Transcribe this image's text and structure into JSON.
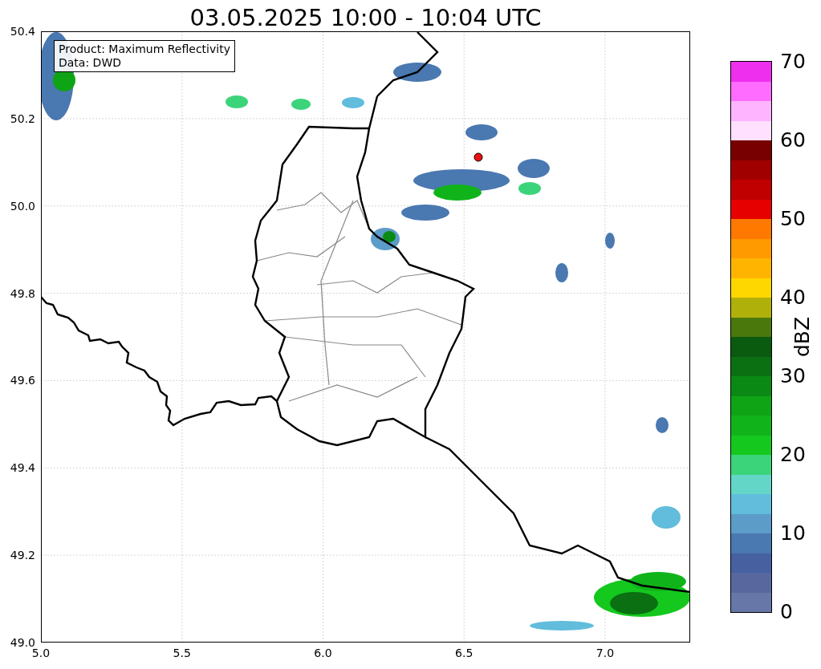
{
  "title": "03.05.2025 10:00 - 10:04 UTC",
  "map": {
    "x_ticks": [
      "5.0",
      "5.5",
      "6.0",
      "6.5",
      "7.0"
    ],
    "y_ticks": [
      "50.4",
      "50.2",
      "50.0",
      "49.8",
      "49.6",
      "49.4",
      "49.2",
      "49.0"
    ],
    "legend_lines": [
      "Product: Maximum Reflectivity",
      "Data: DWD"
    ]
  },
  "colorbar": {
    "label": "dBZ",
    "ticks": [
      "70",
      "60",
      "50",
      "40",
      "30",
      "20",
      "10",
      "0"
    ],
    "bands": [
      {
        "color": "#6677a8"
      },
      {
        "color": "#58689f"
      },
      {
        "color": "#4660a0"
      },
      {
        "color": "#4a78b0"
      },
      {
        "color": "#5b9cc8"
      },
      {
        "color": "#62bcdc"
      },
      {
        "color": "#64d6c8"
      },
      {
        "color": "#3cd47a"
      },
      {
        "color": "#14c81e"
      },
      {
        "color": "#10b41a"
      },
      {
        "color": "#0ea416"
      },
      {
        "color": "#0a8a14"
      },
      {
        "color": "#0a7012"
      },
      {
        "color": "#0a5a10"
      },
      {
        "color": "#4a780c"
      },
      {
        "color": "#b0b00a"
      },
      {
        "color": "#ffd700"
      },
      {
        "color": "#ffb400"
      },
      {
        "color": "#ff9a00"
      },
      {
        "color": "#ff7800"
      },
      {
        "color": "#e60000"
      },
      {
        "color": "#c00000"
      },
      {
        "color": "#a00000"
      },
      {
        "color": "#780000"
      },
      {
        "color": "#ffe0ff"
      },
      {
        "color": "#ffb4ff"
      },
      {
        "color": "#ff6cff"
      },
      {
        "color": "#ee30ee"
      }
    ]
  }
}
